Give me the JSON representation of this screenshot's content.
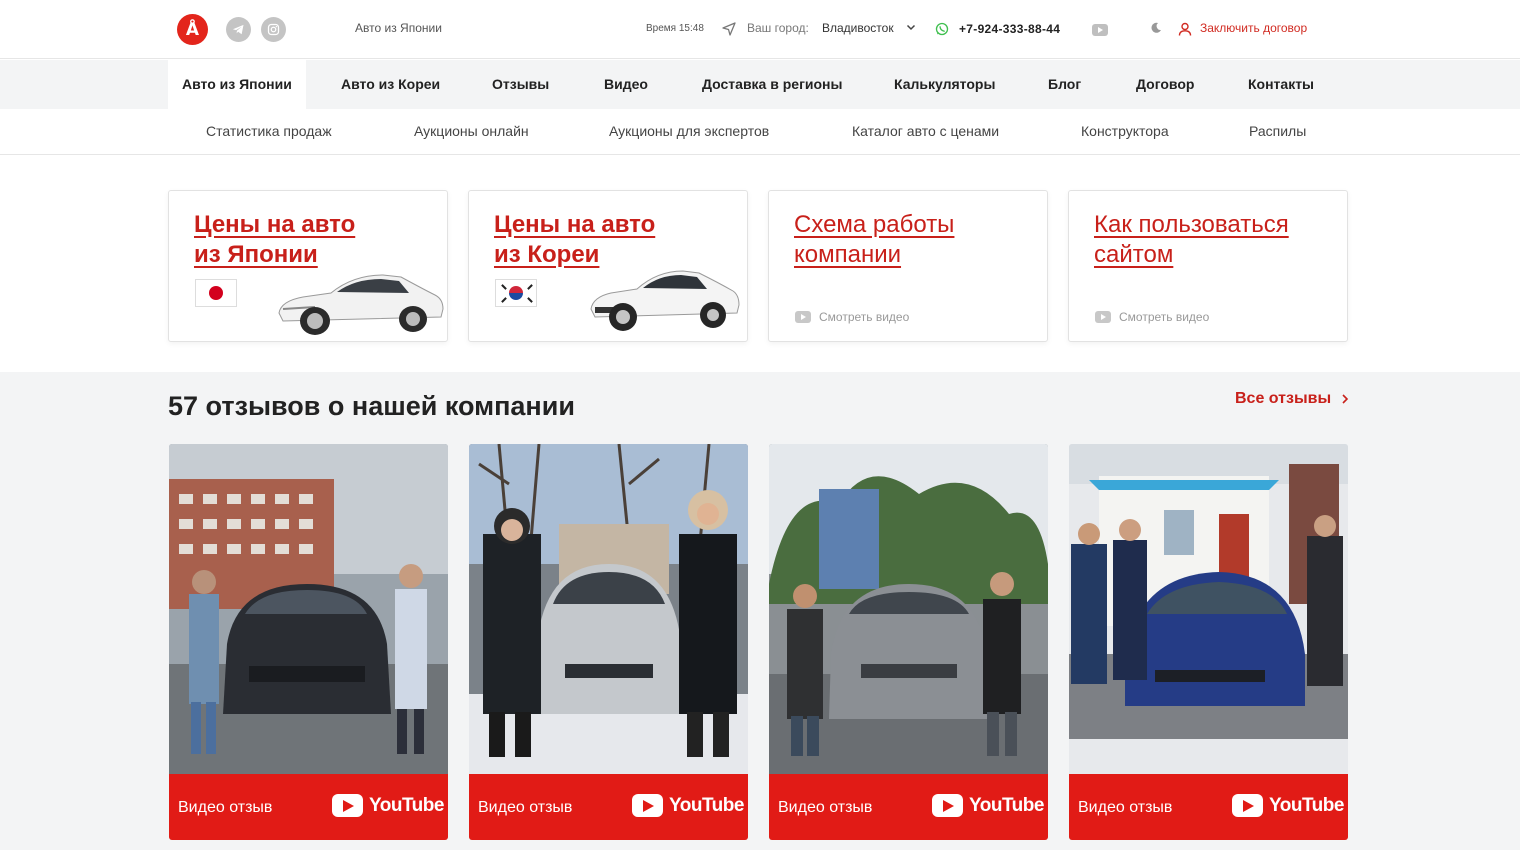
{
  "header": {
    "logo_glyph": "Å",
    "tagline": "Авто из Японии",
    "time": "Время 15:48",
    "city_label": "Ваш город:",
    "city_value": "Владивосток",
    "phone": "+7-924-333-88-44",
    "contract": "Заключить договор"
  },
  "mainnav": {
    "items": [
      {
        "label": "Авто из Японии",
        "active": true
      },
      {
        "label": "Авто из Кореи"
      },
      {
        "label": "Отзывы"
      },
      {
        "label": "Видео"
      },
      {
        "label": "Доставка в регионы"
      },
      {
        "label": "Калькуляторы"
      },
      {
        "label": "Блог"
      },
      {
        "label": "Договор"
      },
      {
        "label": "Контакты"
      }
    ]
  },
  "subnav": {
    "items": [
      {
        "label": "Статистика продаж"
      },
      {
        "label": "Аукционы онлайн"
      },
      {
        "label": "Аукционы для экспертов"
      },
      {
        "label": "Каталог авто с ценами"
      },
      {
        "label": "Конструктора"
      },
      {
        "label": "Распилы"
      }
    ]
  },
  "cards": [
    {
      "title_line1": "Цены на авто",
      "title_line2": "из Японии"
    },
    {
      "title_line1": "Цены на авто",
      "title_line2": "из Кореи"
    },
    {
      "title_line1": "Схема работы",
      "title_line2": "компании",
      "watch": "Смотреть видео"
    },
    {
      "title_line1": "Как пользоваться",
      "title_line2": "сайтом",
      "watch": "Смотреть видео"
    }
  ],
  "reviews": {
    "title": "57 отзывов о нашей компании",
    "all_link": "Все отзывы",
    "videos": [
      {
        "label": "Видео отзыв",
        "brand": "YouTube"
      },
      {
        "label": "Видео отзыв",
        "brand": "YouTube"
      },
      {
        "label": "Видео отзыв",
        "brand": "YouTube"
      },
      {
        "label": "Видео отзыв",
        "brand": "YouTube"
      }
    ]
  },
  "colors": {
    "brand_red": "#c8201a",
    "youtube_red": "#e11b16",
    "nav_bg": "#f3f4f5"
  }
}
